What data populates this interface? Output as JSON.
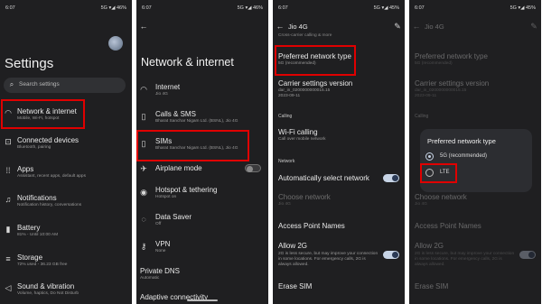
{
  "status_bar": {
    "p1": {
      "time": "6:07",
      "right": "5G ▾◢ 46%"
    },
    "p2": {
      "time": "6:07",
      "right": "5G ▾◢ 46%"
    },
    "p3": {
      "time": "6:07",
      "right": "5G ▾◢ 45%"
    },
    "p4": {
      "time": "6:07",
      "right": "5G ▾◢ 45%"
    }
  },
  "settings": {
    "title": "Settings",
    "search_placeholder": "Search settings",
    "items": [
      {
        "label": "Network & internet",
        "sub": "Mobile, Wi-Fi, hotspot",
        "icon": "wifi-icon"
      },
      {
        "label": "Connected devices",
        "sub": "Bluetooth, pairing",
        "icon": "devices-icon"
      },
      {
        "label": "Apps",
        "sub": "Assistant, recent apps, default apps",
        "icon": "apps-icon"
      },
      {
        "label": "Notifications",
        "sub": "Notification history, conversations",
        "icon": "bell-icon"
      },
      {
        "label": "Battery",
        "sub": "81% - Until 10:00 AM",
        "icon": "battery-icon"
      },
      {
        "label": "Storage",
        "sub": "72% used - 36.23 GB free",
        "icon": "storage-icon"
      },
      {
        "label": "Sound & vibration",
        "sub": "Volume, haptics, Do Not Disturb",
        "icon": "volume-icon"
      }
    ]
  },
  "network": {
    "title": "Network & internet",
    "items": [
      {
        "label": "Internet",
        "sub": "Jio 4G",
        "icon": "wifi-icon"
      },
      {
        "label": "Calls & SMS",
        "sub": "Bharat Sanchar Nigam Ltd. (BSNL), Jio 4G",
        "icon": "sim-card-icon"
      },
      {
        "label": "SIMs",
        "sub": "Bharat Sanchar Nigam Ltd. (BSNL), Jio 4G",
        "icon": "sim-card-icon"
      },
      {
        "label": "Airplane mode",
        "sub": "",
        "icon": "airplane-icon"
      },
      {
        "label": "Hotspot & tethering",
        "sub": "Hotspot on",
        "icon": "hotspot-icon"
      },
      {
        "label": "Data Saver",
        "sub": "Off",
        "icon": "data-saver-icon"
      },
      {
        "label": "VPN",
        "sub": "None",
        "icon": "vpn-icon"
      },
      {
        "label": "Private DNS",
        "sub": "Automatic",
        "icon": ""
      },
      {
        "label": "Adaptive connectivity",
        "sub": "",
        "icon": ""
      }
    ]
  },
  "sim": {
    "title": "Jio 4G",
    "top_cutoff": "Cross-carrier calling & more",
    "items": [
      {
        "label": "Preferred network type",
        "sub": "5G (recommended)"
      },
      {
        "label": "Carrier settings version",
        "sub": "dar_in_0200000000015.15\n2023-09-11"
      }
    ],
    "calling_header": "Calling",
    "wifi_calling": {
      "label": "Wi-Fi calling",
      "sub": "Call over mobile network"
    },
    "network_header": "Network",
    "auto_select": {
      "label": "Automatically select network"
    },
    "choose_network": {
      "label": "Choose network",
      "sub": "Jio 4G"
    },
    "apn": {
      "label": "Access Point Names"
    },
    "allow_2g": {
      "label": "Allow 2G",
      "sub": "2G is less secure, but may improve your connection in some locations. For emergency calls, 2G is always allowed."
    },
    "erase_sim": {
      "label": "Erase SIM"
    }
  },
  "dialog": {
    "title": "Preferred network type",
    "options": [
      {
        "label": "5G (recommended)",
        "selected": true
      },
      {
        "label": "LTE",
        "selected": false
      }
    ]
  },
  "colors": {
    "accent": "#e00000",
    "panel_bg": "#1f1f21",
    "toggle_on": "#c7d4e6"
  }
}
